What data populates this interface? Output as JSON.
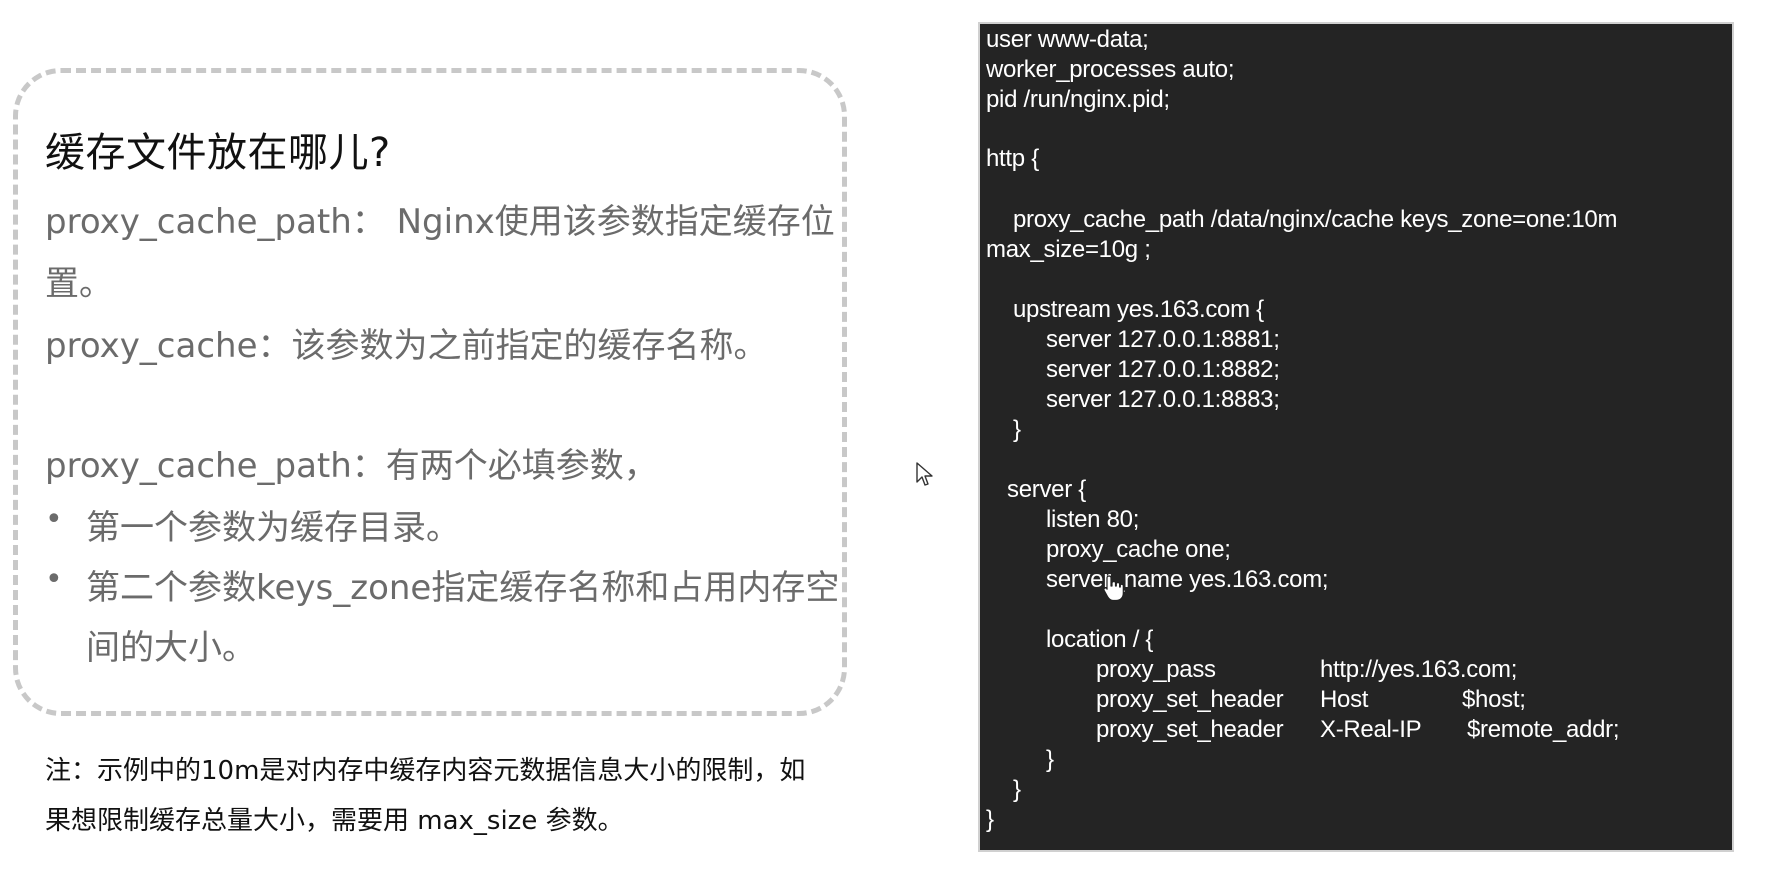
{
  "left": {
    "heading": "缓存文件放在哪儿?",
    "p1_line1": "proxy_cache_path： Nginx使用该参数指定缓存位",
    "p1_line2": "置。",
    "p2": "proxy_cache：该参数为之前指定的缓存名称。",
    "p3": "proxy_cache_path：有两个必填参数，",
    "bullet_symbol": "•",
    "bullet1": "第一个参数为缓存目录。",
    "bullet2_line1": "第二个参数keys_zone指定缓存名称和占用内存空",
    "bullet2_line2": "间的大小。"
  },
  "note": {
    "line1": "注：示例中的10m是对内存中缓存内容元数据信息大小的限制，如",
    "line2": "果想限制缓存总量大小，需要用 max_size 参数。"
  },
  "code": {
    "line1": "user www-data;",
    "line2": "worker_processes auto;",
    "line3": "pid /run/nginx.pid;",
    "line4": "http {",
    "line5": "proxy_cache_path /data/nginx/cache keys_zone=one:10m",
    "line6": "max_size=10g ;",
    "line7": "upstream yes.163.com {",
    "line8": "server 127.0.0.1:8881;",
    "line9": "server 127.0.0.1:8882;",
    "line10": "server 127.0.0.1:8883;",
    "line11": "}",
    "line12": "server {",
    "line13": "listen 80;",
    "line14": "proxy_cache one;",
    "line15": "server_name yes.163.com;",
    "line16": "location / {",
    "line17_key": "proxy_pass",
    "line17_val": "http://yes.163.com;",
    "line18_key": "proxy_set_header",
    "line18_arg": "Host",
    "line18_val": "$host;",
    "line19_key": "proxy_set_header",
    "line19_arg": "X-Real-IP",
    "line19_val": "$remote_addr;",
    "line20": "}",
    "line21": "}",
    "line22": "}"
  },
  "icons": {
    "cursor": "arrow-cursor-icon",
    "hand": "hand-pointer-icon"
  }
}
